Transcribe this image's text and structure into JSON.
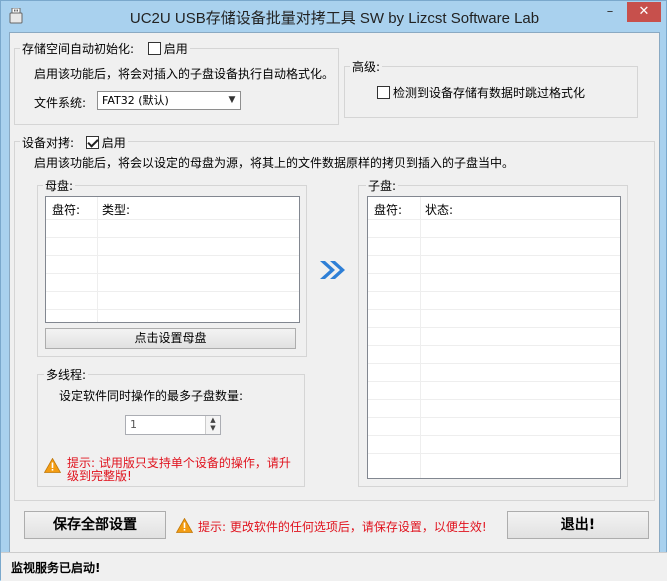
{
  "window": {
    "title": "UC2U USB存储设备批量对拷工具 SW  by Lizcst Software Lab",
    "controls": {
      "minimize": "–",
      "close": "✕"
    }
  },
  "auto_format": {
    "legend": "存储空间自动初始化:",
    "enable_label": "启用",
    "enabled": false,
    "description": "启用该功能后，将会对插入的子盘设备执行自动格式化。",
    "filesystem_label": "文件系统:",
    "filesystem_value": "FAT32 (默认)",
    "advanced": {
      "legend": "高级:",
      "skip_label": "检测到设备存储有数据时跳过格式化",
      "skip_checked": false
    }
  },
  "copy": {
    "legend": "设备对拷:",
    "enable_label": "启用",
    "enabled": true,
    "description": "启用该功能后，将会以设定的母盘为源，将其上的文件数据原样的拷贝到插入的子盘当中。",
    "source": {
      "legend": "母盘:",
      "columns": [
        "盘符:",
        "类型:"
      ],
      "rows": [],
      "set_button": "点击设置母盘"
    },
    "arrow_icon": "double-chevron-right-icon",
    "target": {
      "legend": "子盘:",
      "columns": [
        "盘符:",
        "状态:"
      ],
      "rows": []
    },
    "multithread": {
      "legend": "多线程:",
      "label": "设定软件同时操作的最多子盘数量:",
      "value": "1",
      "warning_line1": "提示: 试用版只支持单个设备的操作，请升",
      "warning_line2": "级到完整版!"
    }
  },
  "footer": {
    "save_button": "保存全部设置",
    "notice": "提示: 更改软件的任何选项后，请保存设置，以便生效!",
    "exit_button": "退出!"
  },
  "status_bar": {
    "text": "监视服务已启动!"
  },
  "colors": {
    "accent": "#2e7fd6",
    "warning": "#e0131e",
    "frame": "#a9d1ee"
  }
}
